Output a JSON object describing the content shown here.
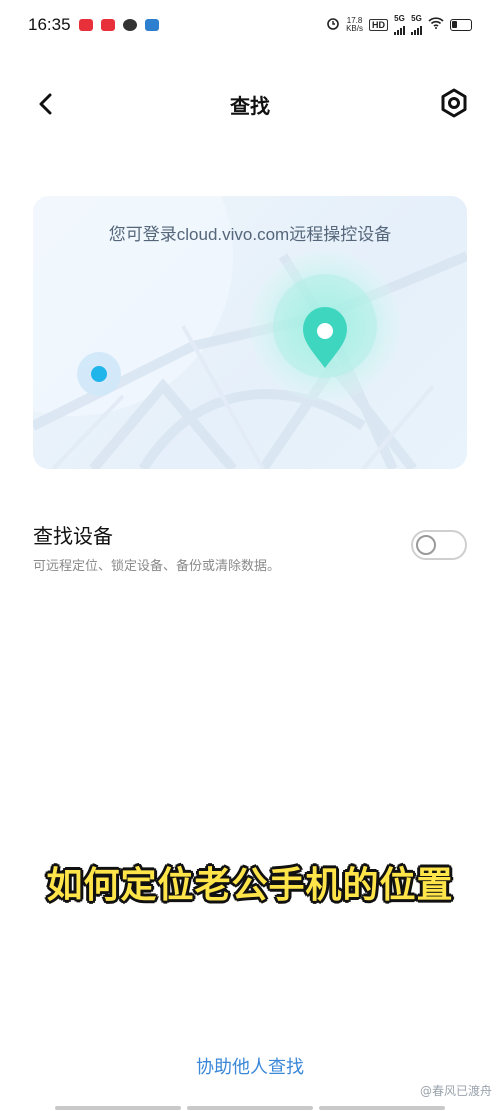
{
  "status_bar": {
    "time": "16:35",
    "speed_top": "17.8",
    "speed_unit": "KB/s",
    "hd_label": "HD",
    "net1": "5G",
    "net2": "5G",
    "app_icon_colors": [
      "#e8303a",
      "#e8303a",
      "#333333",
      "#2f7fd0"
    ]
  },
  "header": {
    "back_icon": "chevron-left",
    "title": "查找",
    "settings_icon": "gear"
  },
  "hero": {
    "text": "您可登录cloud.vivo.com远程操控设备",
    "accent_color": "#3fd6c0",
    "dot_color": "#1fb4ea"
  },
  "find_device": {
    "title": "查找设备",
    "description": "可远程定位、锁定设备、备份或清除数据。",
    "enabled": false
  },
  "overlay": {
    "caption": "如何定位老公手机的位置"
  },
  "footer": {
    "help_link": "协助他人查找",
    "watermark": "@春风已渡舟"
  }
}
